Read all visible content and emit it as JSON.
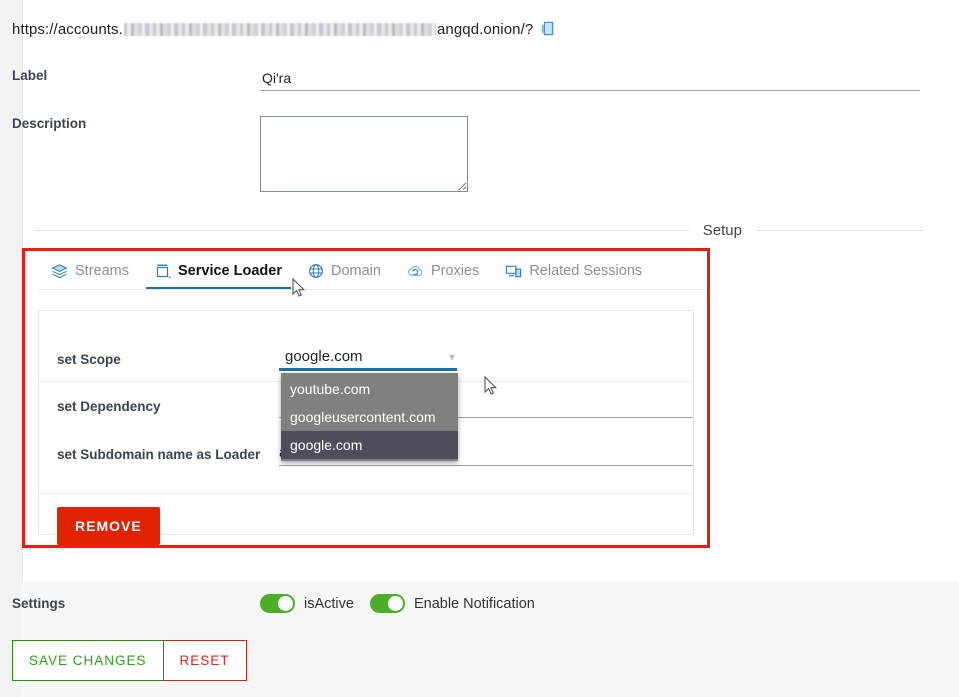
{
  "url_bar": {
    "prefix": "https://accounts.",
    "redacted": true,
    "suffix": "angqd.onion/?",
    "copy_icon": "copy-icon"
  },
  "fields": {
    "label_caption": "Label",
    "label_value": "Qi'ra",
    "description_caption": "Description",
    "description_value": "",
    "description_placeholder": ""
  },
  "setup": {
    "divider_title": "Setup"
  },
  "tabs": [
    {
      "label": "Streams",
      "icon": "layers-icon",
      "active": false
    },
    {
      "label": "Service Loader",
      "icon": "service-loader-icon",
      "active": true
    },
    {
      "label": "Domain",
      "icon": "globe-icon",
      "active": false
    },
    {
      "label": "Proxies",
      "icon": "cloud-refresh-icon",
      "active": false
    },
    {
      "label": "Related Sessions",
      "icon": "devices-icon",
      "active": false
    }
  ],
  "service_loader": {
    "rows": [
      {
        "label": "set Scope",
        "value": "google.com",
        "type": "select"
      },
      {
        "label": "set Dependency",
        "value": "",
        "type": "text"
      },
      {
        "label": "set Subdomain name as Loader",
        "value": "accounts",
        "type": "text"
      }
    ],
    "scope_dropdown": {
      "open": true,
      "options": [
        "youtube.com",
        "googleusercontent.com",
        "google.com"
      ],
      "selected": "google.com"
    },
    "remove_label": "REMOVE"
  },
  "settings": {
    "caption": "Settings",
    "toggles": [
      {
        "label": "isActive",
        "on": true
      },
      {
        "label": "Enable Notification",
        "on": true
      }
    ]
  },
  "actions": {
    "save_label": "SAVE CHANGES",
    "reset_label": "RESET"
  },
  "colors": {
    "accent_blue": "#1a6ea8",
    "remove_red": "#e02200",
    "annotation_red": "#f01c0d",
    "toggle_green": "#4caf27",
    "save_green": "#2f9e1b",
    "reset_red": "#e0241a",
    "dropdown_bg": "#808080",
    "dropdown_selected": "#4e4e5b"
  }
}
